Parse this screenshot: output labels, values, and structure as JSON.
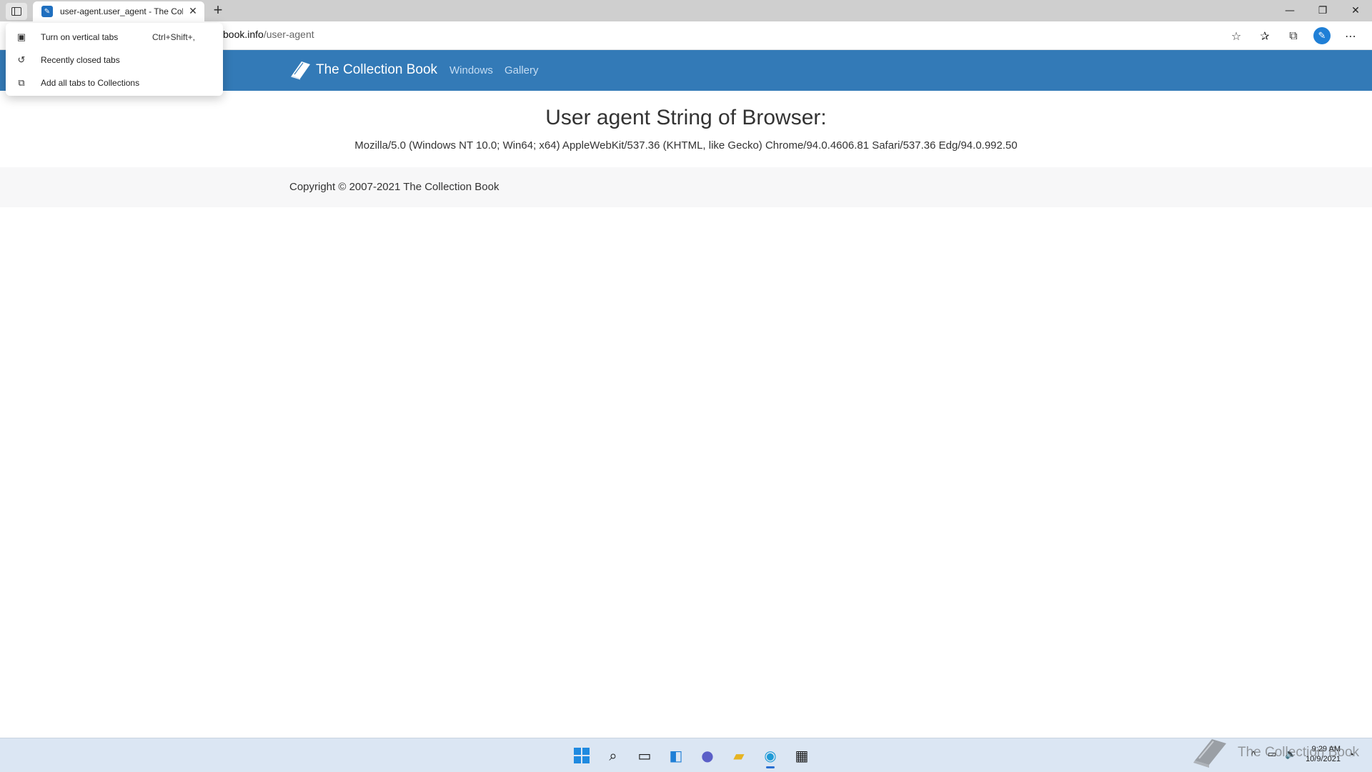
{
  "browser": {
    "tab_title": "user-agent.user_agent - The Coll",
    "address_host_visible": "book.info",
    "address_path": "/user-agent",
    "new_tab_label": "+",
    "window_controls": {
      "minimize": "—",
      "restore": "❐",
      "close": "✕"
    }
  },
  "tab_actions_menu": {
    "items": [
      {
        "label": "Turn on vertical tabs",
        "shortcut": "Ctrl+Shift+,",
        "icon": "vertical-tabs-icon"
      },
      {
        "label": "Recently closed tabs",
        "shortcut": "",
        "icon": "history-icon"
      },
      {
        "label": "Add all tabs to Collections",
        "shortcut": "",
        "icon": "collections-add-icon"
      }
    ]
  },
  "site": {
    "brand": "The Collection Book",
    "nav_links": [
      "Windows",
      "Gallery"
    ],
    "nav_color": "#337ab7",
    "heading": "User agent String of Browser:",
    "user_agent": "Mozilla/5.0 (Windows NT 10.0; Win64; x64) AppleWebKit/537.36 (KHTML, like Gecko) Chrome/94.0.4606.81 Safari/537.36 Edg/94.0.992.50",
    "footer_copyright": "Copyright © 2007-2021 The Collection Book"
  },
  "taskbar": {
    "apps": [
      "start-icon",
      "search-icon",
      "task-view-icon",
      "widgets-icon",
      "chat-icon",
      "file-explorer-icon",
      "edge-icon",
      "store-icon"
    ],
    "clock_time": "9:29 AM",
    "clock_date": "10/9/2021"
  },
  "watermark": {
    "text": "The Collection Book"
  }
}
